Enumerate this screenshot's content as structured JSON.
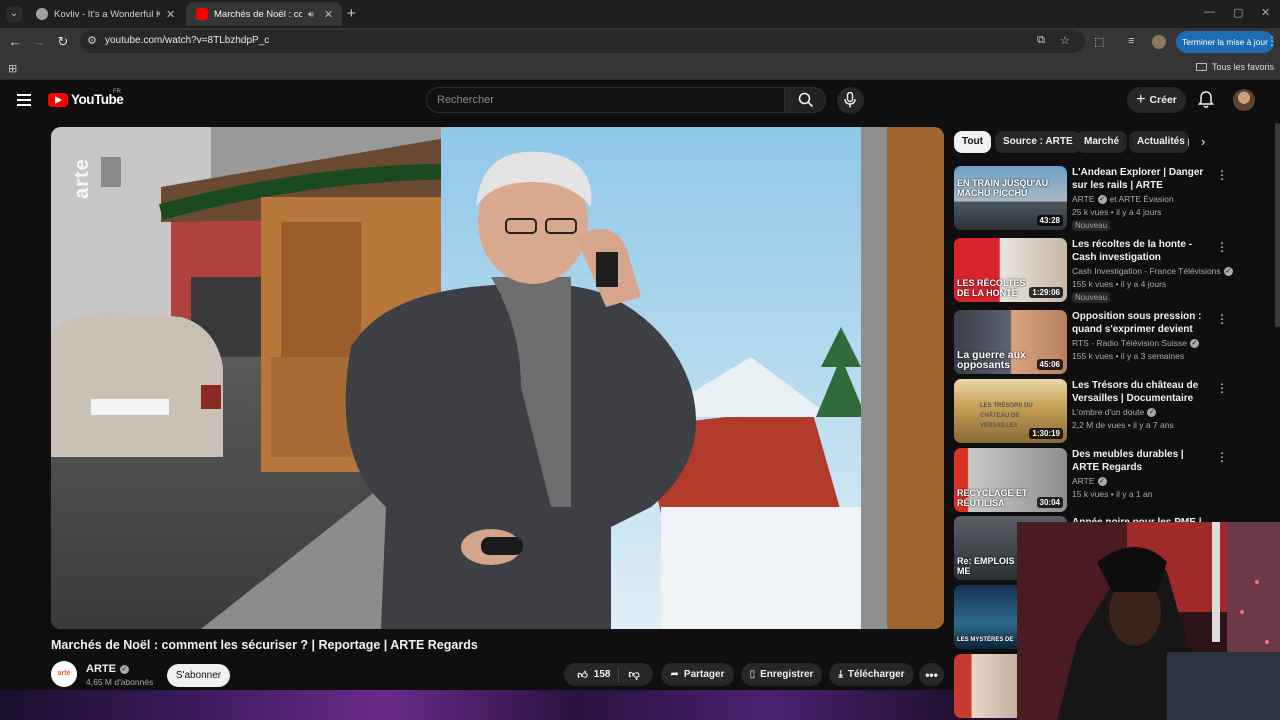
{
  "browser": {
    "tabs": [
      {
        "title": "Kovliv - It's a Wonderful Knife (",
        "active": false
      },
      {
        "title": "Marchés de Noël : commen",
        "active": true
      }
    ],
    "url": "youtube.com/watch?v=8TLbzhdpP_c",
    "update_button": "Terminer la mise à jour",
    "bookmarks_all": "Tous les favoris"
  },
  "header": {
    "logo": "YouTube",
    "country": "FR",
    "search_placeholder": "Rechercher",
    "create_label": "Créer"
  },
  "video": {
    "watermark": "arte",
    "title": "Marchés de Noël : comment les sécuriser ? | Reportage | ARTE Regards",
    "channel": "ARTE",
    "channel_avatar_text": "arte",
    "subscribers": "4,65 M d'abonnés",
    "subscribe_label": "S'abonner",
    "likes": "158",
    "share_label": "Partager",
    "save_label": "Enregistrer",
    "download_label": "Télécharger"
  },
  "chips": [
    "Tout",
    "Source : ARTE",
    "Marché",
    "Actualités p"
  ],
  "recommendations": [
    {
      "title": "L'Andean Explorer | Danger sur les rails | ARTE",
      "channel": "ARTE",
      "channel_suffix": "et ARTE Évasion",
      "meta": "25 k vues • il y a 4 jours",
      "badge": "Nouveau",
      "duration": "43:28",
      "thumb_caption": "EN TRAIN JUSQU'AU MACHU PICCHU"
    },
    {
      "title": "Les récoltes de la honte - Cash investigation",
      "channel": "Cash Investigation - France Télévisions",
      "channel_suffix": "",
      "meta": "155 k vues • il y a 4 jours",
      "badge": "Nouveau",
      "duration": "1:29:06",
      "thumb_caption": "LES RÉCOLTES DE LA HONTE"
    },
    {
      "title": "Opposition sous pression : quand s'exprimer devient risqu...",
      "channel": "RTS - Radio Télévision Suisse",
      "channel_suffix": "",
      "meta": "155 k vues • il y a 3 semaines",
      "badge": "",
      "duration": "45:06",
      "thumb_caption": "La guerre aux opposants"
    },
    {
      "title": "Les Trésors du château de Versailles | Documentaire",
      "channel": "L'ombre d'un doute",
      "channel_suffix": "",
      "meta": "2,2 M de vues • il y a 7 ans",
      "badge": "",
      "duration": "1:30:19",
      "thumb_caption": "LES TRÉSORS DU CHÂTEAU DE VERSAILLES"
    },
    {
      "title": "Des meubles durables | ARTE Regards",
      "channel": "ARTE",
      "channel_suffix": "",
      "meta": "15 k vues • il y a 1 an",
      "badge": "",
      "duration": "30:04",
      "thumb_caption": "RECYCLAGE ET RÉUTILISA"
    },
    {
      "title": "Année noire pour les PME |",
      "channel": "",
      "channel_suffix": "",
      "meta": "",
      "badge": "",
      "duration": "",
      "thumb_caption": "Re: EMPLOIS ME"
    },
    {
      "title": "",
      "channel": "",
      "channel_suffix": "",
      "meta": "",
      "badge": "",
      "duration": "",
      "thumb_caption": "LES MYSTÈRES DE"
    },
    {
      "title": "",
      "channel": "",
      "channel_suffix": "",
      "meta": "",
      "badge": "",
      "duration": "",
      "thumb_caption": ""
    }
  ]
}
